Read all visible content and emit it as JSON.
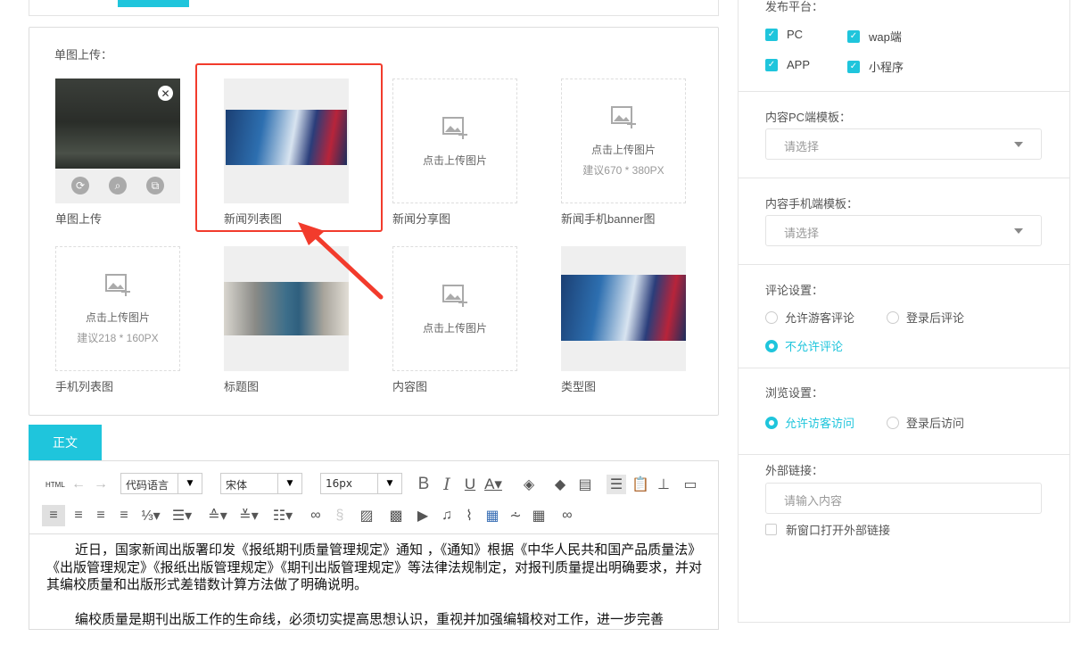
{
  "top": {
    "button_label": ""
  },
  "upload": {
    "section_label": "单图上传：",
    "upload_hint": "点击上传图片",
    "items": [
      {
        "label": "单图上传",
        "state": "uploaded"
      },
      {
        "label": "新闻列表图",
        "state": "uploaded"
      },
      {
        "label": "新闻分享图",
        "state": "empty"
      },
      {
        "label": "新闻手机banner图",
        "state": "empty",
        "hint": "建议670 * 380PX"
      },
      {
        "label": "手机列表图",
        "state": "empty",
        "hint": "建议218 * 160PX"
      },
      {
        "label": "标题图",
        "state": "uploaded"
      },
      {
        "label": "内容图",
        "state": "empty"
      },
      {
        "label": "类型图",
        "state": "uploaded"
      }
    ]
  },
  "editor": {
    "tab": "正文",
    "html_label": "HTML",
    "code_lang": "代码语言",
    "font": "宋体",
    "size": "16px",
    "paragraphs": [
      "近日，国家新闻出版署印发《报纸期刊质量管理规定》通知 ，《通知》根据《中华人民共和国产品质量法》《出版管理规定》《报纸出版管理规定》《期刊出版管理规定》等法律法规制定，对报刊质量提出明确要求，并对其编校质量和出版形式差错数计算方法做了明确说明。",
      "编校质量是期刊出版工作的生命线，必须切实提高思想认识，重视并加强编辑校对工作，进一步完善"
    ]
  },
  "sidebar": {
    "platform_label": "发布平台：",
    "platforms": [
      {
        "label": "PC",
        "checked": true
      },
      {
        "label": "wap端",
        "checked": true
      },
      {
        "label": "APP",
        "checked": true
      },
      {
        "label": "小程序",
        "checked": true
      }
    ],
    "pc_template_label": "内容PC端模板：",
    "mobile_template_label": "内容手机端模板：",
    "select_placeholder": "请选择",
    "comment_label": "评论设置：",
    "comment_options": [
      "允许游客评论",
      "登录后评论",
      "不允许评论"
    ],
    "comment_selected": "不允许评论",
    "browse_label": "浏览设置：",
    "browse_options": [
      "允许访客访问",
      "登录后访问"
    ],
    "browse_selected": "允许访客访问",
    "link_label": "外部链接：",
    "link_placeholder": "请输入内容",
    "new_window_label": "新窗口打开外部链接",
    "new_window_checked": false
  },
  "colors": {
    "accent": "#1fc5dc",
    "highlight": "#f23b2c"
  }
}
